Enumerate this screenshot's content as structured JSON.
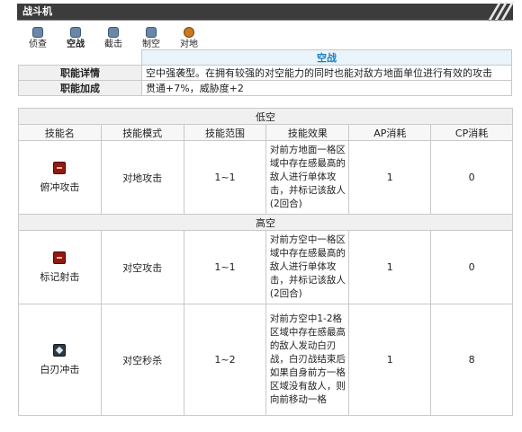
{
  "header": {
    "title": "战斗机"
  },
  "tabs": [
    {
      "label": "侦查",
      "icon": "scout-icon"
    },
    {
      "label": "空战",
      "icon": "air-combat-icon",
      "active": true
    },
    {
      "label": "截击",
      "icon": "intercept-icon"
    },
    {
      "label": "制空",
      "icon": "air-control-icon"
    },
    {
      "label": "对地",
      "icon": "ground-attack-icon"
    }
  ],
  "info": {
    "role_heading": "空战",
    "rows": [
      {
        "label": "职能详情",
        "value": "空中强袭型。在拥有较强的对空能力的同时也能对敌方地面单位进行有效的攻击"
      },
      {
        "label": "职能加成",
        "value": "贯通+7%，威胁度+2"
      }
    ]
  },
  "skills": {
    "section_low": "低空",
    "section_high": "高空",
    "columns": [
      "技能名",
      "技能模式",
      "技能范围",
      "技能效果",
      "AP消耗",
      "CP消耗"
    ],
    "low": [
      {
        "name": "俯冲攻击",
        "mode": "对地攻击",
        "range": "1~1",
        "effect": "对前方地面一格区域中存在感最高的敌人进行单体攻击，并标记该敌人(2回合)",
        "ap": "1",
        "cp": "0",
        "icon": "dive-attack-icon"
      }
    ],
    "high": [
      {
        "name": "标记射击",
        "mode": "对空攻击",
        "range": "1~1",
        "effect": "对前方空中一格区域中存在感最高的敌人进行单体攻击，并标记该敌人(2回合)",
        "ap": "1",
        "cp": "0",
        "icon": "mark-shot-icon"
      },
      {
        "name": "白刃冲击",
        "mode": "对空秒杀",
        "range": "1~2",
        "effect": "对前方空中1-2格区域中存在感最高的敌人发动白刃战，白刃战结束后如果自身前方一格区域没有敌人，则向前移动一格",
        "ap": "1",
        "cp": "8",
        "icon": "blade-charge-icon"
      }
    ]
  },
  "colors": {
    "header_bg": "#3c3c3c",
    "accent": "#1a7fc2",
    "label_bg": "#f0f0f0"
  }
}
